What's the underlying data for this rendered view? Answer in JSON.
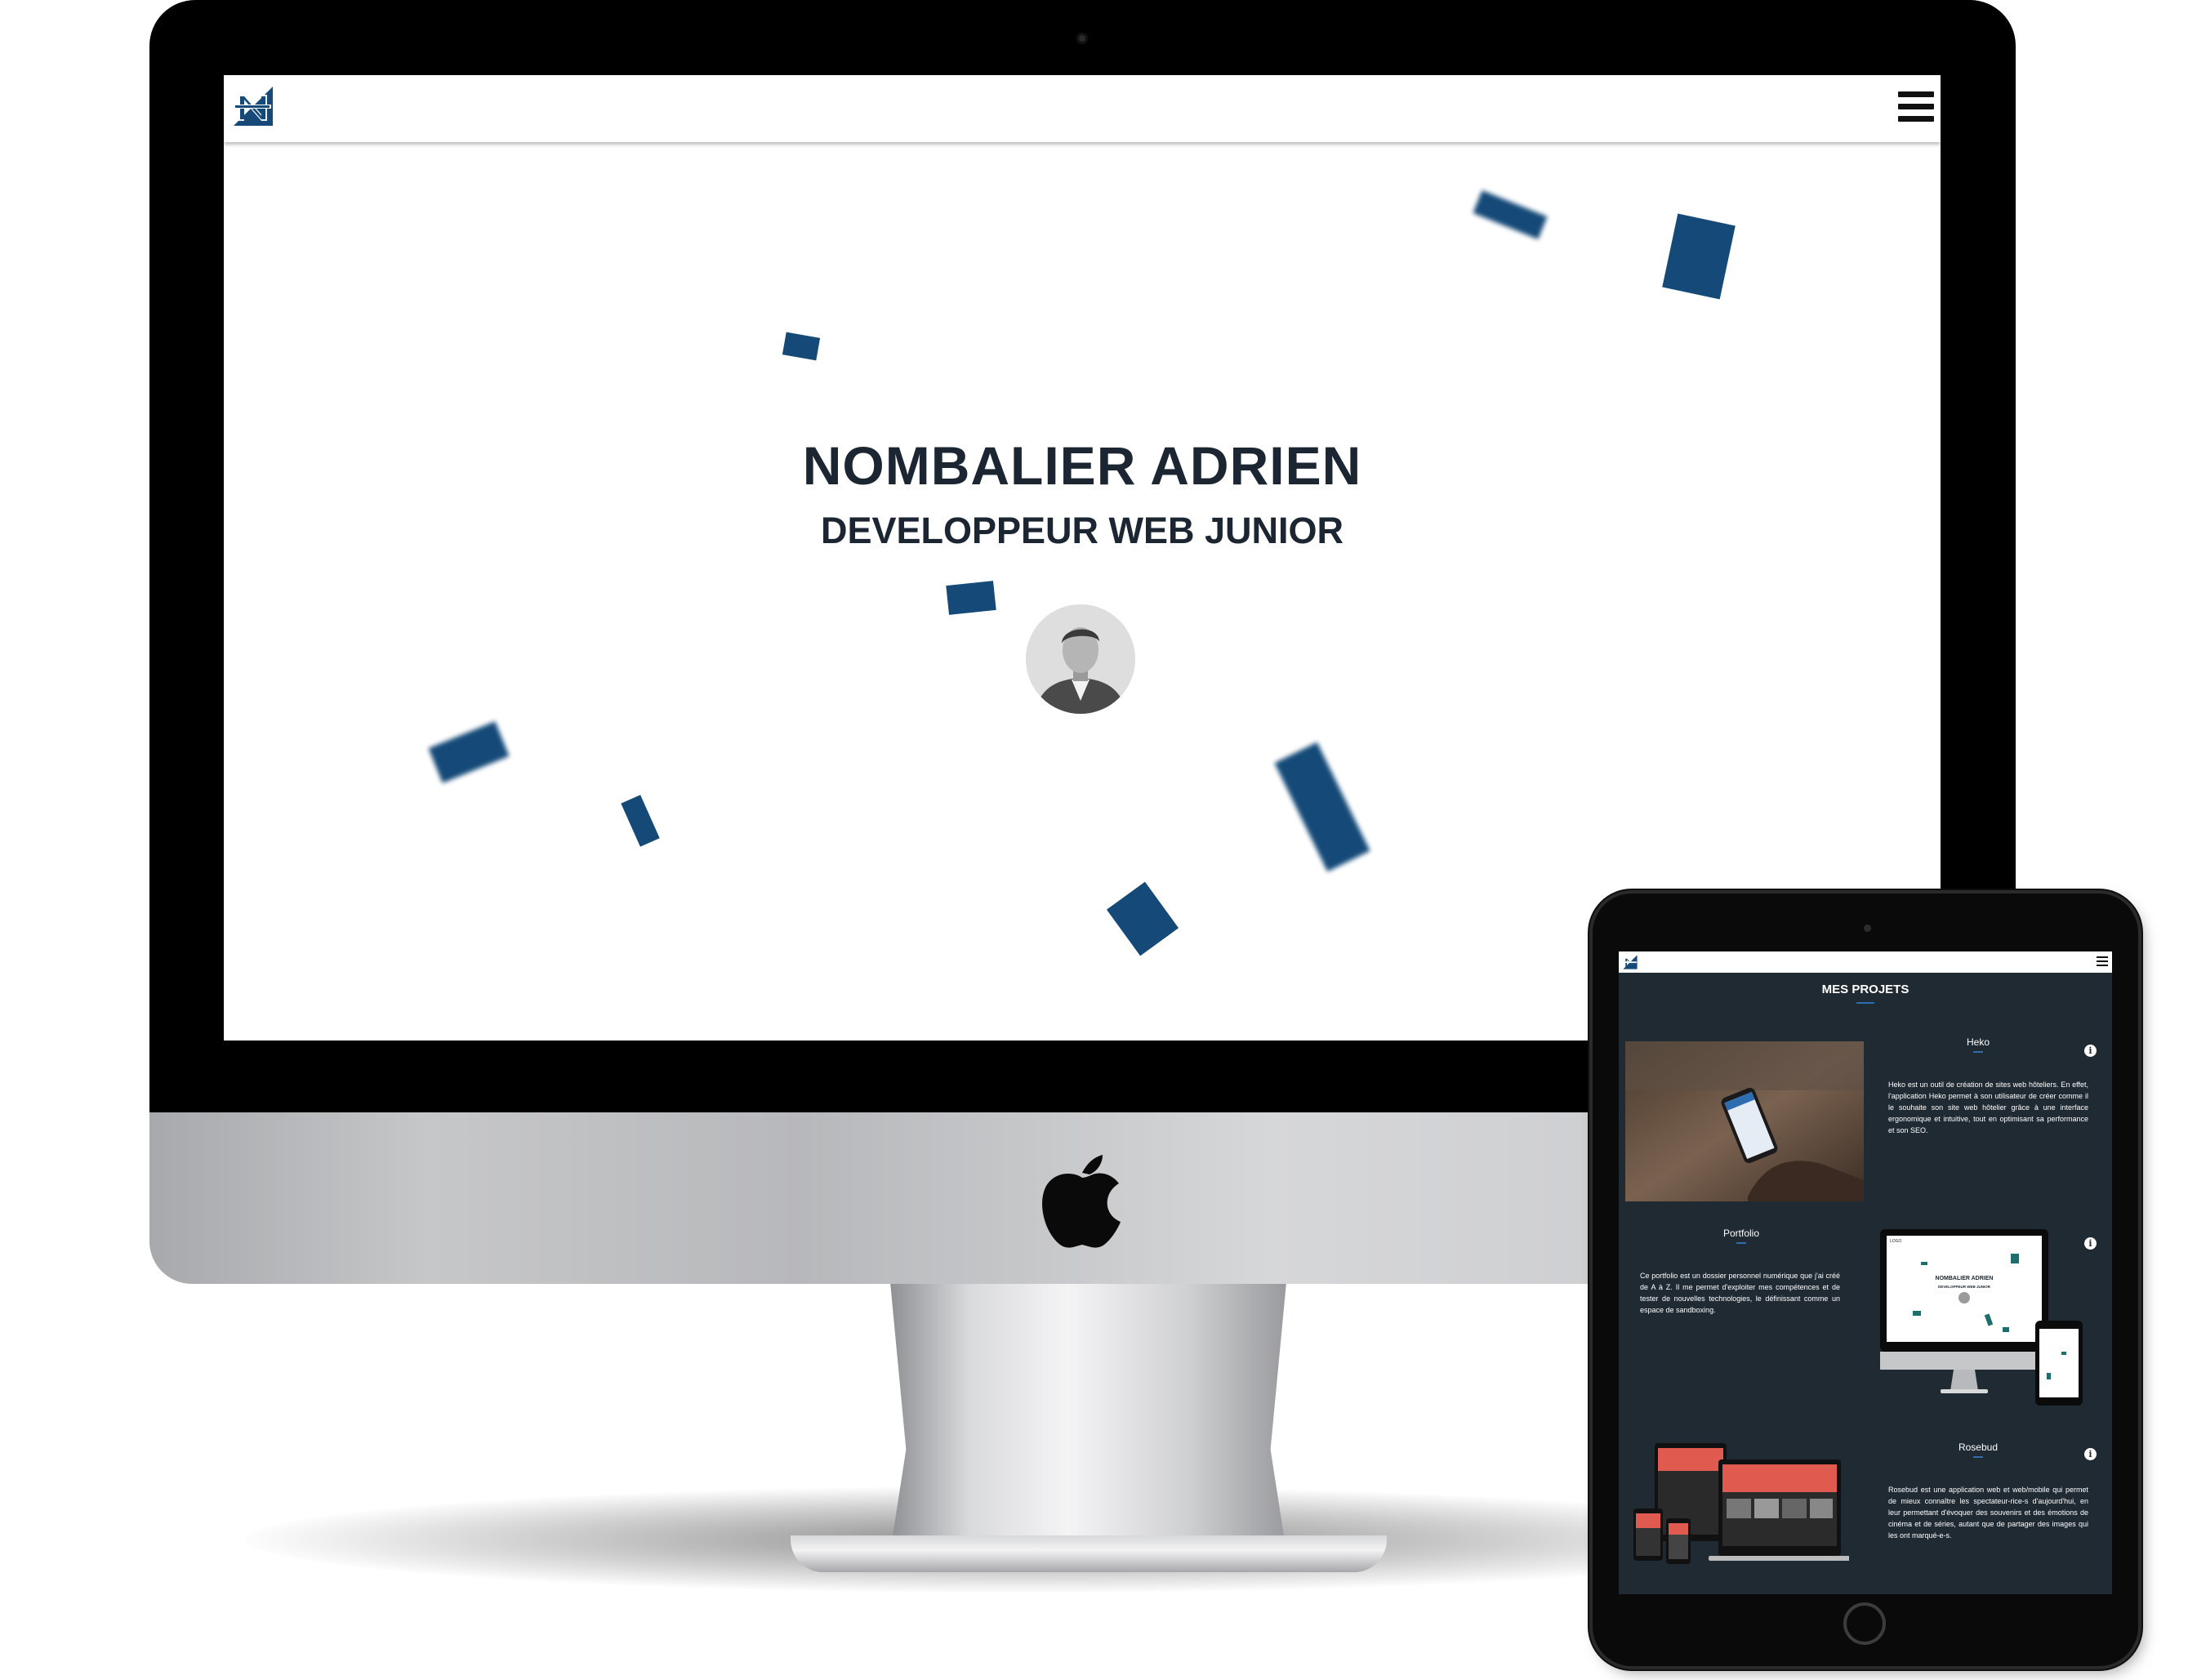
{
  "desktop_site": {
    "hero": {
      "name": "NOMBALIER ADRIEN",
      "role": "DEVELOPPEUR WEB JUNIOR"
    },
    "brand_color": "#154a78",
    "icons": {
      "logo": "n-logo-icon",
      "menu": "hamburger-menu-icon"
    }
  },
  "tablet_site": {
    "section_title": "MES PROJETS",
    "projects": [
      {
        "title": "Heko",
        "description": "Heko est un outil de création de sites web hôteliers. En effet, l'application Heko permet à son utilisateur de créer comme il le souhaite son site web hôtelier grâce à une interface ergonomique et intuitive, tout en optimisant sa performance et son SEO."
      },
      {
        "title": "Portfolio",
        "description": "Ce portfolio est un dossier personnel numérique que j'ai créé de A à Z. Il me permet d'exploiter mes compétences et de tester de nouvelles technologies, le définissant comme un espace de sandboxing."
      },
      {
        "title": "Rosebud",
        "description": "Rosebud est une application web et web/mobile qui permet de mieux connaître les spectateur-rice-s d'aujourd'hui, en leur permettant d'évoquer des souvenirs et des émotions de cinéma et de séries, autant que de partager des images qui les ont marqué-e-s."
      }
    ],
    "info_label": "i",
    "thumb_heading": "NOMBALIER ADRIEN",
    "thumb_subheading": "DEVELOPPEUR WEB JUNIOR",
    "thumb_logo_text": "LOGO",
    "accent_color": "#2e6db0",
    "background_color": "#1f2a33"
  }
}
